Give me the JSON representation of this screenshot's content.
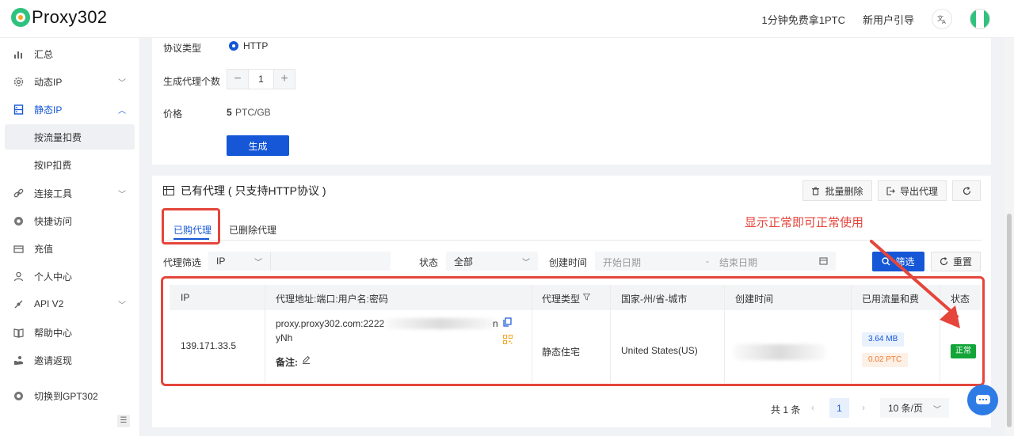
{
  "header": {
    "logo_text": "Proxy302",
    "free_ptc_link": "1分钟免费拿1PTC",
    "new_user_guide": "新用户引导",
    "lang_icon": "translate-icon"
  },
  "sidebar": {
    "items": [
      {
        "label": "汇总",
        "icon": "chart-icon"
      },
      {
        "label": "动态IP",
        "icon": "gear-icon"
      },
      {
        "label": "静态IP",
        "icon": "server-icon"
      },
      {
        "label": "按流量扣费"
      },
      {
        "label": "按IP扣费"
      },
      {
        "label": "连接工具",
        "icon": "link-icon"
      },
      {
        "label": "快捷访问",
        "icon": "chrome-icon"
      },
      {
        "label": "充值",
        "icon": "card-icon"
      },
      {
        "label": "个人中心",
        "icon": "user-icon"
      },
      {
        "label": "API V2",
        "icon": "api-icon"
      },
      {
        "label": "帮助中心",
        "icon": "book-icon"
      },
      {
        "label": "邀请返现",
        "icon": "gift-icon"
      },
      {
        "label": "切换到GPT302",
        "icon": "switch-icon"
      }
    ]
  },
  "form": {
    "protocol_label": "协议类型",
    "protocol_value": "HTTP",
    "count_label": "生成代理个数",
    "count_value": "1",
    "price_label": "价格",
    "price_value": "5",
    "price_unit": "PTC/GB",
    "generate_button": "生成"
  },
  "proxies_card": {
    "title": "已有代理 ( 只支持HTTP协议 )",
    "bulk_delete": "批量删除",
    "export": "导出代理",
    "tabs": [
      "已购代理",
      "已删除代理"
    ],
    "filter_label": "代理筛选",
    "filter_type": "IP",
    "status_label": "状态",
    "status_value": "全部",
    "created_label": "创建时间",
    "start_date": "开始日期",
    "date_sep": "-",
    "end_date": "结束日期",
    "search_button": "筛选",
    "reset_button": "重置",
    "annotation": "显示正常即可正常使用"
  },
  "table": {
    "columns": [
      "IP",
      "代理地址:端口:用户名:密码",
      "代理类型",
      "国家-州/省-城市",
      "创建时间",
      "已用流量和费",
      "状态"
    ],
    "rows": [
      {
        "ip": "139.171.33.5",
        "address_line1": "proxy.proxy302.com:2222",
        "address_tail": "n",
        "address_line2": "yNh",
        "note_label": "备注:",
        "type": "静态住宅",
        "location": "United States(US)",
        "created": "",
        "traffic": "3.64 MB",
        "cost": "0.02 PTC",
        "status": "正常"
      }
    ]
  },
  "pagination": {
    "total": "共 1 条",
    "current_page": "1",
    "page_size": "10 条/页"
  },
  "colors": {
    "primary": "#1557d6",
    "annotation_red": "#e5453b",
    "status_green": "#13a538"
  }
}
